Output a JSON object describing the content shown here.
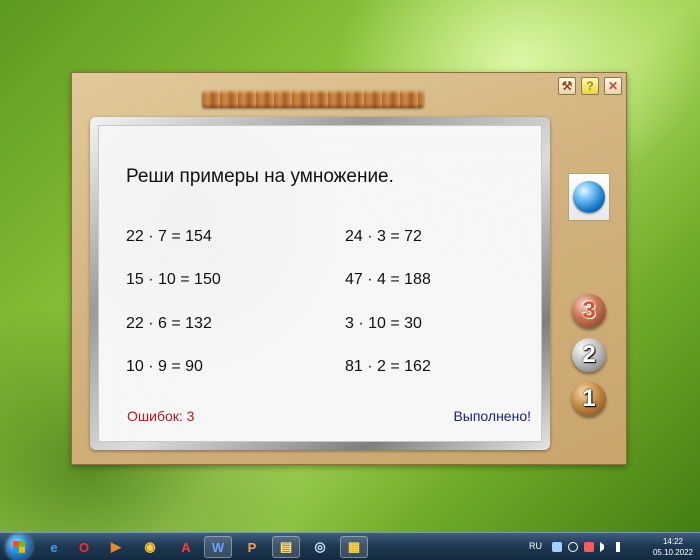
{
  "app": {
    "task_title": "Реши примеры на умножение.",
    "examples_left": [
      "22 · 7 = 154",
      "15 · 10 = 150",
      "22 · 6 = 132",
      "10 · 9 = 90"
    ],
    "examples_right": [
      "24 · 3 = 72",
      "47 · 4 = 188",
      "3 · 10 = 30",
      "81 · 2 = 162"
    ],
    "errors_label": "Ошибок: 3",
    "done_label": "Выполнено!",
    "levels": [
      "3",
      "2",
      "1"
    ],
    "window_buttons": {
      "tool": "⚒",
      "help": "?",
      "close": "✕"
    }
  },
  "taskbar": {
    "language": "RU",
    "time": "14:22",
    "date": "05.10.2022",
    "apps": [
      {
        "name": "internet-explorer",
        "glyph": "e"
      },
      {
        "name": "opera",
        "glyph": "O"
      },
      {
        "name": "media-player",
        "glyph": "▶"
      },
      {
        "name": "chrome",
        "glyph": "◉"
      },
      {
        "name": "acrobat",
        "glyph": "A"
      },
      {
        "name": "word",
        "glyph": "W"
      },
      {
        "name": "powerpoint",
        "glyph": "P"
      },
      {
        "name": "explorer",
        "glyph": "▤"
      },
      {
        "name": "browser",
        "glyph": "◎"
      },
      {
        "name": "app",
        "glyph": "▦"
      }
    ]
  },
  "colors": {
    "error_text": "#b01c1c",
    "done_text": "#1a237e"
  }
}
